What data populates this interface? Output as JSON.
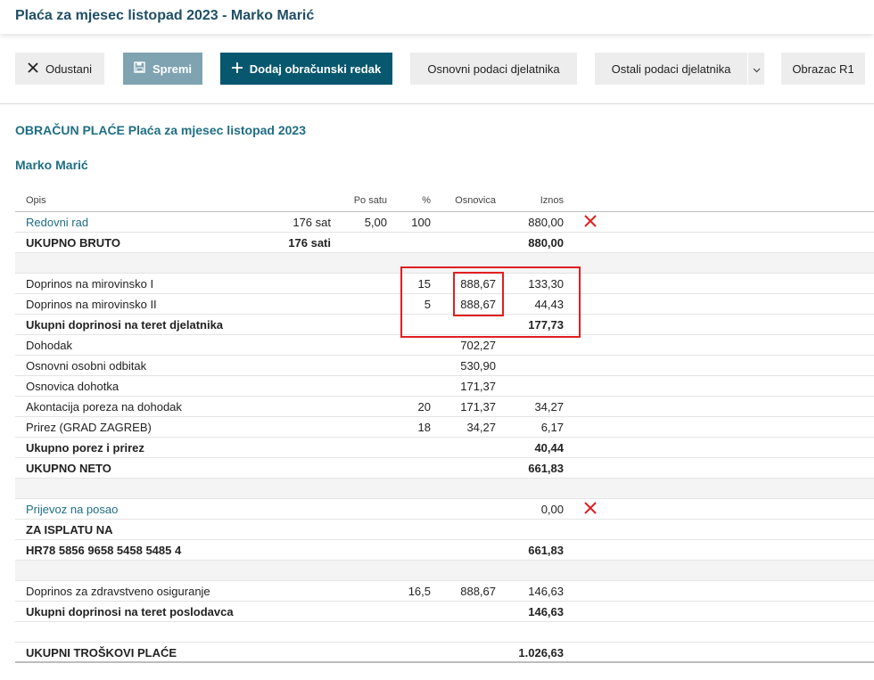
{
  "header": {
    "title": "Plaća za mjesec listopad 2023 - Marko Marić"
  },
  "toolbar": {
    "cancel_label": "Odustani",
    "save_label": "Spremi",
    "add_label": "Dodaj obračunski redak",
    "basic_label": "Osnovni podaci djelatnika",
    "other_label": "Ostali podaci djelatnika",
    "form_label": "Obrazac R1"
  },
  "section": {
    "heading": "OBRAČUN PLAĆE Plaća za mjesec listopad 2023",
    "employee": "Marko Marić"
  },
  "table": {
    "headers": {
      "opis": "Opis",
      "po_satu": "Po satu",
      "pct": "%",
      "osnovica": "Osnovica",
      "iznos": "Iznos"
    },
    "rows": [
      {
        "opis": "Redovni rad",
        "qty": "176 sat",
        "rate": "5,00",
        "pct": "100",
        "base": "",
        "amt": "880,00"
      },
      {
        "opis": "UKUPNO BRUTO",
        "qty": "176 sati",
        "rate": "",
        "pct": "",
        "base": "",
        "amt": "880,00"
      },
      {
        "opis": "",
        "qty": "",
        "rate": "",
        "pct": "",
        "base": "",
        "amt": ""
      },
      {
        "opis": "Doprinos na mirovinsko I",
        "qty": "",
        "rate": "",
        "pct": "15",
        "base": "888,67",
        "amt": "133,30"
      },
      {
        "opis": "Doprinos na mirovinsko II",
        "qty": "",
        "rate": "",
        "pct": "5",
        "base": "888,67",
        "amt": "44,43"
      },
      {
        "opis": "Ukupni doprinosi na teret djelatnika",
        "qty": "",
        "rate": "",
        "pct": "",
        "base": "",
        "amt": "177,73"
      },
      {
        "opis": "Dohodak",
        "qty": "",
        "rate": "",
        "pct": "",
        "base": "702,27",
        "amt": ""
      },
      {
        "opis": "Osnovni osobni odbitak",
        "qty": "",
        "rate": "",
        "pct": "",
        "base": "530,90",
        "amt": ""
      },
      {
        "opis": "Osnovica dohotka",
        "qty": "",
        "rate": "",
        "pct": "",
        "base": "171,37",
        "amt": ""
      },
      {
        "opis": "Akontacija poreza na dohodak",
        "qty": "",
        "rate": "",
        "pct": "20",
        "base": "171,37",
        "amt": "34,27"
      },
      {
        "opis": "Prirez (GRAD ZAGREB)",
        "qty": "",
        "rate": "",
        "pct": "18",
        "base": "34,27",
        "amt": "6,17"
      },
      {
        "opis": "Ukupno porez i prirez",
        "qty": "",
        "rate": "",
        "pct": "",
        "base": "",
        "amt": "40,44"
      },
      {
        "opis": "UKUPNO NETO",
        "qty": "",
        "rate": "",
        "pct": "",
        "base": "",
        "amt": "661,83"
      },
      {
        "opis": "",
        "qty": "",
        "rate": "",
        "pct": "",
        "base": "",
        "amt": ""
      },
      {
        "opis": "Prijevoz na posao",
        "qty": "",
        "rate": "",
        "pct": "",
        "base": "",
        "amt": "0,00"
      },
      {
        "opis": "ZA ISPLATU NA",
        "qty": "",
        "rate": "",
        "pct": "",
        "base": "",
        "amt": ""
      },
      {
        "opis": "HR78 5856 9658 5458 5485 4",
        "qty": "",
        "rate": "",
        "pct": "",
        "base": "",
        "amt": "661,83"
      },
      {
        "opis": "",
        "qty": "",
        "rate": "",
        "pct": "",
        "base": "",
        "amt": ""
      },
      {
        "opis": "Doprinos za zdravstveno osiguranje",
        "qty": "",
        "rate": "",
        "pct": "16,5",
        "base": "888,67",
        "amt": "146,63"
      },
      {
        "opis": "Ukupni doprinosi na teret poslodavca",
        "qty": "",
        "rate": "",
        "pct": "",
        "base": "",
        "amt": "146,63"
      },
      {
        "opis": "",
        "qty": "",
        "rate": "",
        "pct": "",
        "base": "",
        "amt": ""
      },
      {
        "opis": "UKUPNI TROŠKOVI PLAĆE",
        "qty": "",
        "rate": "",
        "pct": "",
        "base": "",
        "amt": "1.026,63"
      }
    ]
  },
  "icons": {
    "delete": "close-icon",
    "cancel": "close-icon",
    "save": "save-icon",
    "add": "plus-icon",
    "dropdown": "chevron-down-icon"
  },
  "colors": {
    "primary": "#07576f",
    "link": "#1f6e84",
    "highlight": "#e02020",
    "delete": "#e02020"
  }
}
